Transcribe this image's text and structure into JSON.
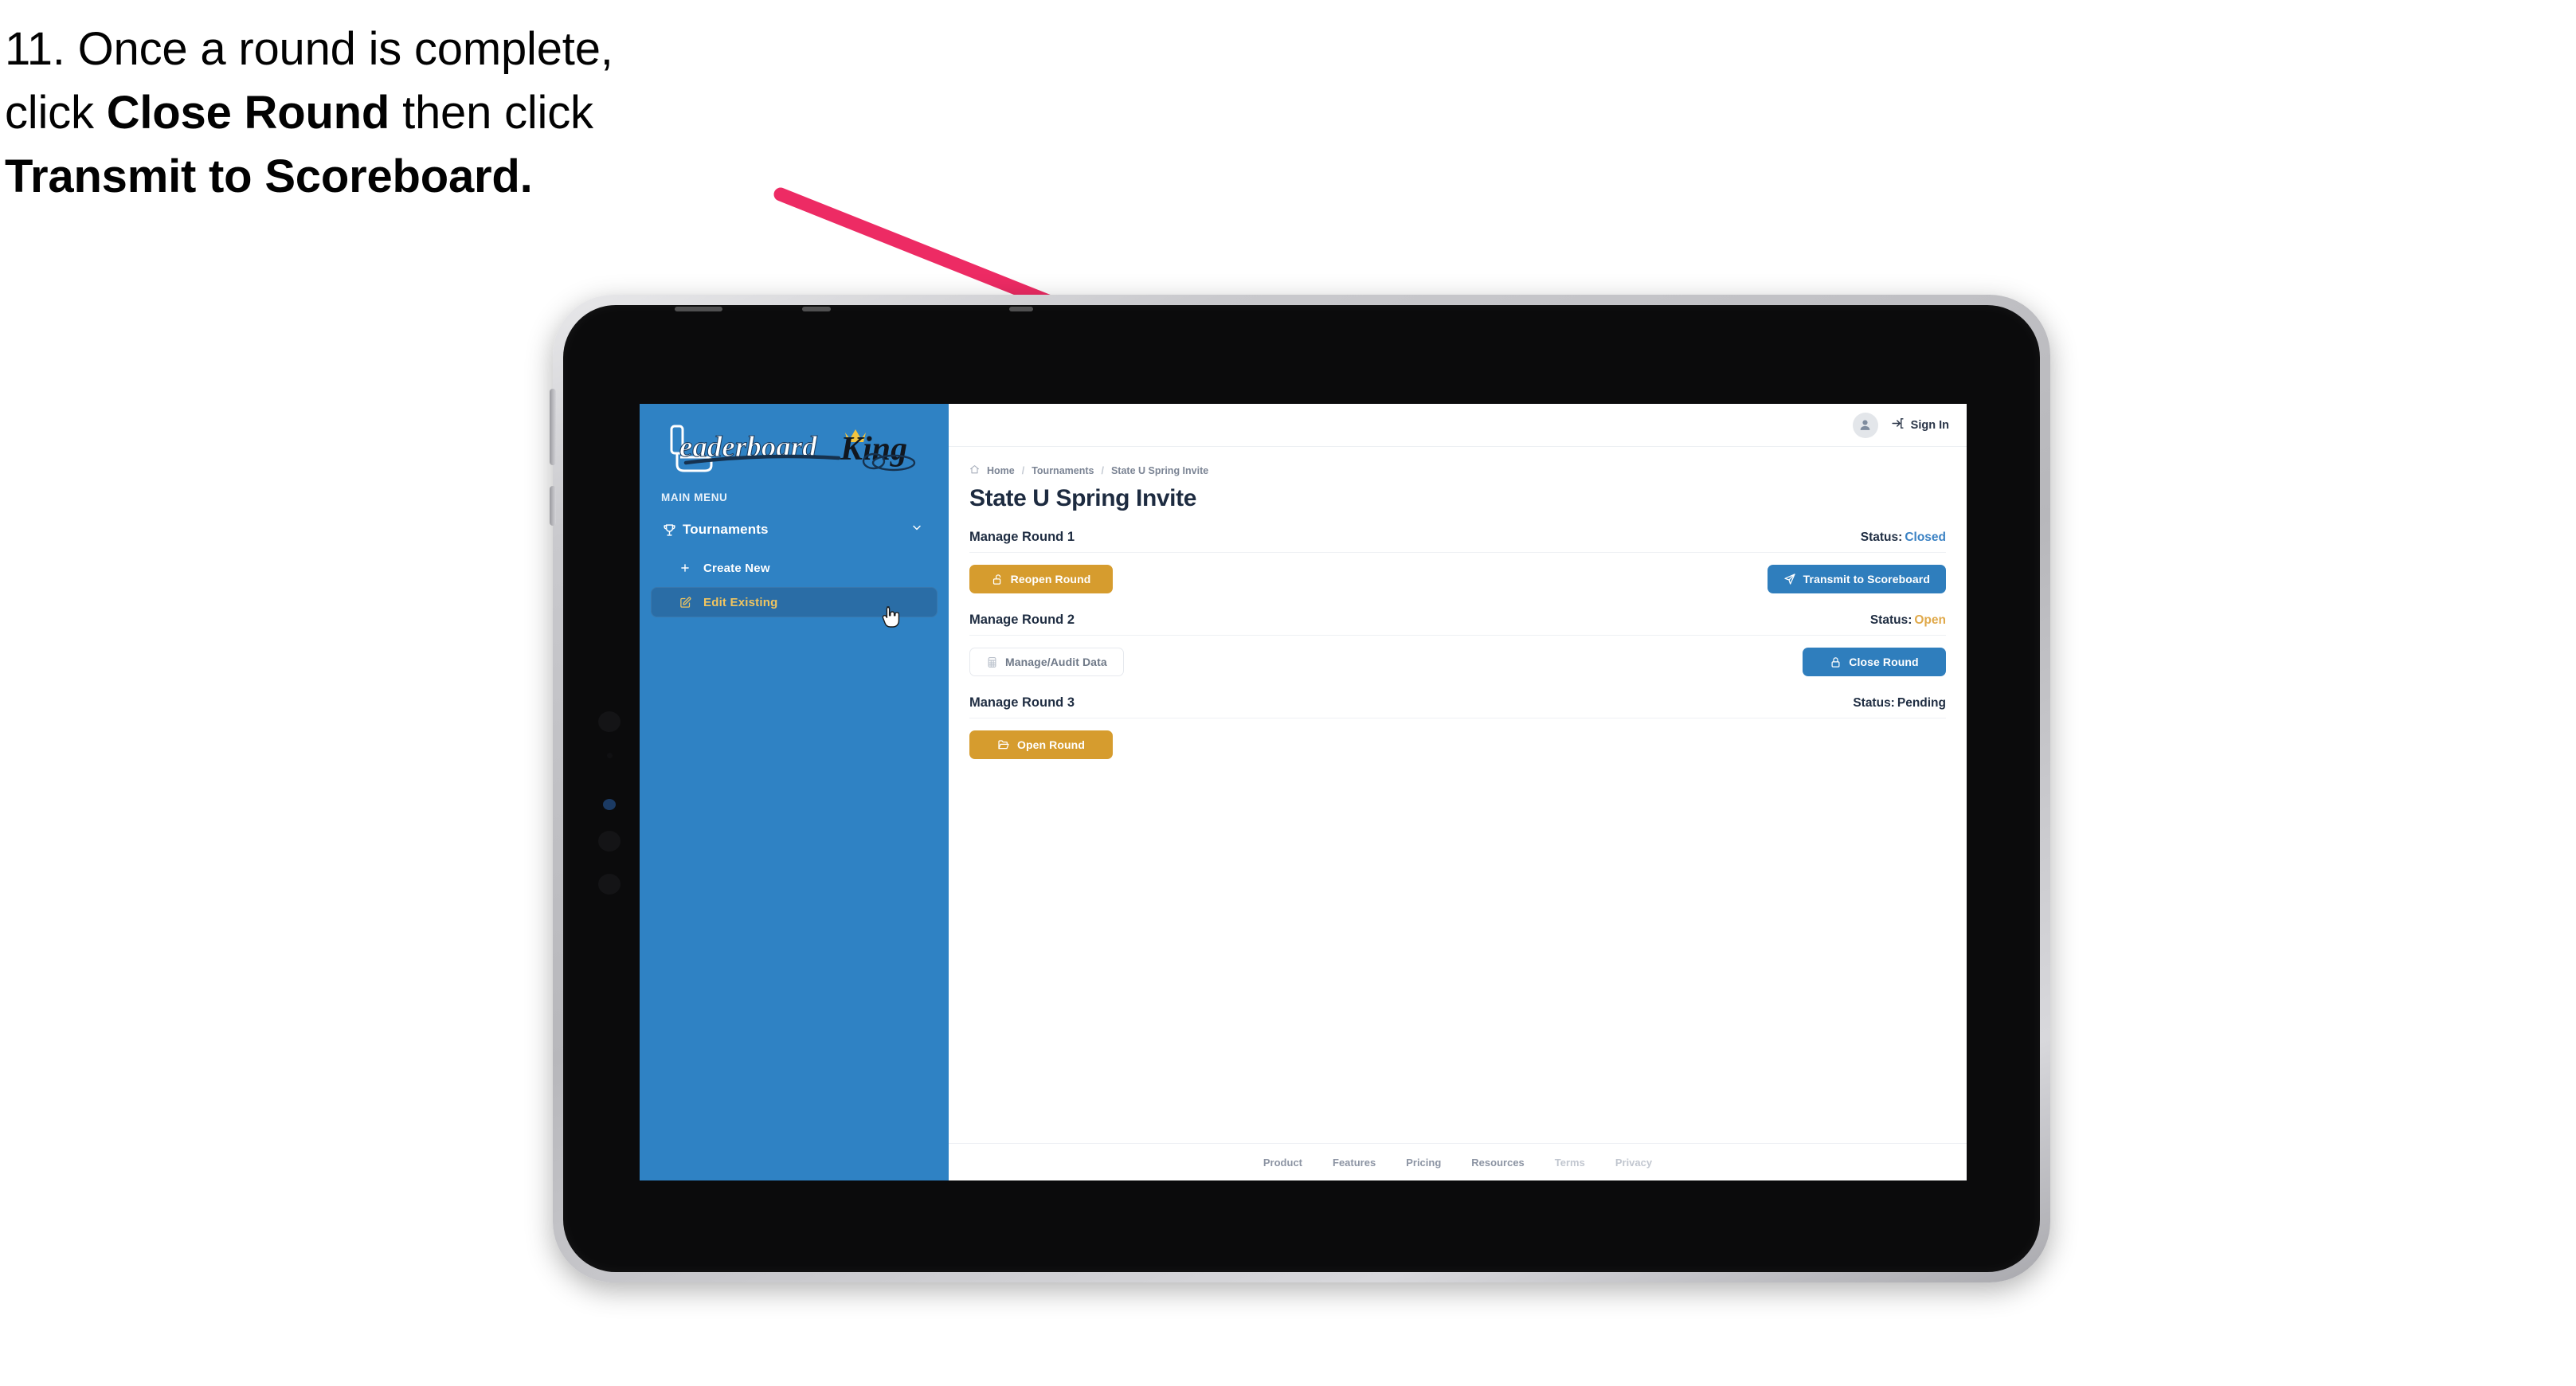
{
  "caption": {
    "line1_prefix": "11. Once a round is complete,",
    "line2_prefix": "click ",
    "line2_bold": "Close Round",
    "line2_suffix": " then click",
    "line3_bold": "Transmit to Scoreboard."
  },
  "annotation": {
    "arrow_color": "#ED2B64"
  },
  "app": {
    "sidebar": {
      "logo_text_primary": "Leaderboard",
      "logo_text_secondary": "King",
      "section_label": "MAIN MENU",
      "items": [
        {
          "label": "Tournaments",
          "icon": "trophy-icon",
          "expanded": true,
          "chevron": "chevron-down-icon"
        },
        {
          "label": "Create New",
          "icon": "plus-icon",
          "active": false
        },
        {
          "label": "Edit Existing",
          "icon": "edit-pencil-icon",
          "active": true
        }
      ],
      "bg_color": "#2F82C4",
      "active_item_bg": "#2A6DA6",
      "active_item_text_color": "#F0C560"
    },
    "topbar": {
      "avatar_icon": "user-avatar-icon",
      "signin_icon": "sign-in-arrow-icon",
      "signin_label": "Sign In"
    },
    "breadcrumb": {
      "home_icon": "home-icon",
      "items": [
        "Home",
        "Tournaments",
        "State U Spring Invite"
      ],
      "separator": "/"
    },
    "page_title": "State U Spring Invite",
    "status_label": "Status:",
    "rounds": [
      {
        "title": "Manage Round 1",
        "status_value": "Closed",
        "status_color": "#3B82C4",
        "left_button": {
          "label": "Reopen Round",
          "icon": "unlock-icon",
          "style": "gold"
        },
        "right_button": {
          "label": "Transmit to Scoreboard",
          "icon": "paper-plane-icon",
          "style": "blue"
        }
      },
      {
        "title": "Manage Round 2",
        "status_value": "Open",
        "status_color": "#E0A94A",
        "left_button": {
          "label": "Manage/Audit Data",
          "icon": "calculator-grid-icon",
          "style": "ghost"
        },
        "right_button": {
          "label": "Close Round",
          "icon": "lock-icon",
          "style": "blue"
        }
      },
      {
        "title": "Manage Round 3",
        "status_value": "Pending",
        "status_color": "#1F2D42",
        "left_button": {
          "label": "Open Round",
          "icon": "open-folder-icon",
          "style": "gold"
        },
        "right_button": null
      }
    ],
    "footer": {
      "links": [
        {
          "label": "Product",
          "muted": false
        },
        {
          "label": "Features",
          "muted": false
        },
        {
          "label": "Pricing",
          "muted": false
        },
        {
          "label": "Resources",
          "muted": false
        },
        {
          "label": "Terms",
          "muted": true
        },
        {
          "label": "Privacy",
          "muted": true
        }
      ]
    },
    "colors": {
      "gold": "#D69C2E",
      "blue": "#2F7EBD",
      "sidebar_blue": "#2F82C4"
    }
  }
}
